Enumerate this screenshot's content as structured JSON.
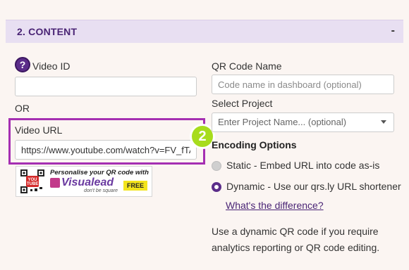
{
  "section": {
    "title": "2. CONTENT",
    "toggle": "-"
  },
  "left": {
    "video_id_label": "Video ID",
    "help_icon": "?",
    "or_label": "OR",
    "video_url_label": "Video URL",
    "video_url_value": "https://www.youtube.com/watch?v=FV_fTA",
    "step_number": "2",
    "ad": {
      "headline": "Personalise your QR code with",
      "brand": "Visualead",
      "tagline": "don't be square",
      "cta": "FREE",
      "tile_text": "YOU TUBE"
    }
  },
  "right": {
    "qr_name_label": "QR Code Name",
    "qr_name_placeholder": "Code name in dashboard (optional)",
    "project_label": "Select Project",
    "project_placeholder": "Enter Project Name... (optional)",
    "encoding_title": "Encoding Options",
    "options": [
      {
        "label": "Static - Embed URL into code as-is",
        "selected": false
      },
      {
        "label": "Dynamic - Use our qrs.ly URL shortener",
        "selected": true
      }
    ],
    "difference_link": "What's the difference?",
    "info_text": "Use a dynamic QR code if you require analytics reporting or QR code editing."
  },
  "colors": {
    "accent": "#5b2d8a",
    "highlight": "#a52fb2",
    "badge": "#a7dc1d",
    "header_bg": "#e8dff2"
  }
}
